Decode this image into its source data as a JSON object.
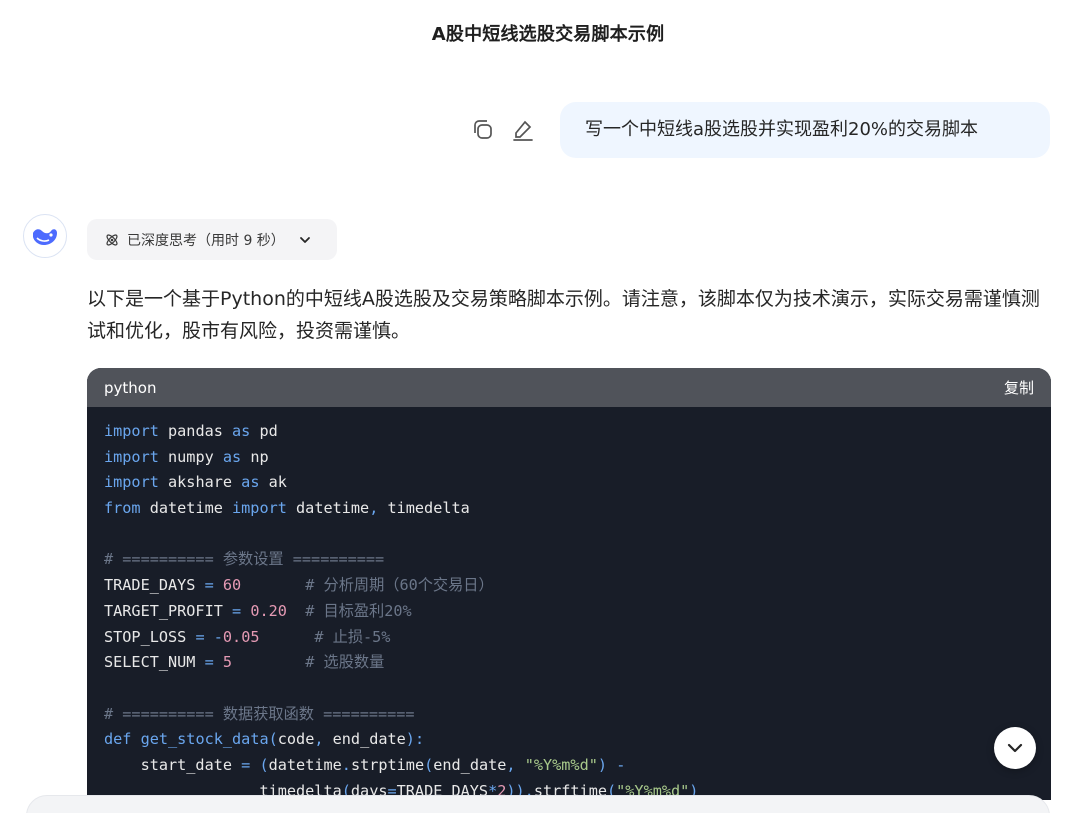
{
  "header": {
    "title": "A股中短线选股交易脚本示例"
  },
  "user_message": {
    "text": "写一个中短线a股选股并实现盈利20%的交易脚本"
  },
  "assistant": {
    "thinking_label": "已深度思考（用时 9 秒）",
    "intro": "以下是一个基于Python的中短线A股选股及交易策略脚本示例。请注意，该脚本仅为技术演示，实际交易需谨慎测试和优化，股市有风险，投资需谨慎。",
    "code": {
      "language": "python",
      "copy_label": "复制",
      "lines": [
        [
          [
            "kw",
            "import"
          ],
          [
            "t",
            " pandas "
          ],
          [
            "kw",
            "as"
          ],
          [
            "t",
            " pd"
          ]
        ],
        [
          [
            "kw",
            "import"
          ],
          [
            "t",
            " numpy "
          ],
          [
            "kw",
            "as"
          ],
          [
            "t",
            " np"
          ]
        ],
        [
          [
            "kw",
            "import"
          ],
          [
            "t",
            " akshare "
          ],
          [
            "kw",
            "as"
          ],
          [
            "t",
            " ak"
          ]
        ],
        [
          [
            "kw",
            "from"
          ],
          [
            "t",
            " datetime "
          ],
          [
            "kw",
            "import"
          ],
          [
            "t",
            " datetime"
          ],
          [
            "op",
            ","
          ],
          [
            "t",
            " timedelta"
          ]
        ],
        [],
        [
          [
            "cm",
            "# ========== 参数设置 =========="
          ]
        ],
        [
          [
            "t",
            "TRADE_DAYS "
          ],
          [
            "op",
            "="
          ],
          [
            "t",
            " "
          ],
          [
            "num",
            "60"
          ],
          [
            "t",
            "       "
          ],
          [
            "cm",
            "# 分析周期（60个交易日）"
          ]
        ],
        [
          [
            "t",
            "TARGET_PROFIT "
          ],
          [
            "op",
            "="
          ],
          [
            "t",
            " "
          ],
          [
            "num",
            "0.20"
          ],
          [
            "t",
            "  "
          ],
          [
            "cm",
            "# 目标盈利20%"
          ]
        ],
        [
          [
            "t",
            "STOP_LOSS "
          ],
          [
            "op",
            "="
          ],
          [
            "t",
            " "
          ],
          [
            "op",
            "-"
          ],
          [
            "num",
            "0.05"
          ],
          [
            "t",
            "      "
          ],
          [
            "cm",
            "# 止损-5%"
          ]
        ],
        [
          [
            "t",
            "SELECT_NUM "
          ],
          [
            "op",
            "="
          ],
          [
            "t",
            " "
          ],
          [
            "num",
            "5"
          ],
          [
            "t",
            "        "
          ],
          [
            "cm",
            "# 选股数量"
          ]
        ],
        [],
        [
          [
            "cm",
            "# ========== 数据获取函数 =========="
          ]
        ],
        [
          [
            "kw",
            "def"
          ],
          [
            "t",
            " "
          ],
          [
            "fn",
            "get_stock_data"
          ],
          [
            "op",
            "("
          ],
          [
            "t",
            "code"
          ],
          [
            "op",
            ","
          ],
          [
            "t",
            " end_date"
          ],
          [
            "op",
            "):"
          ]
        ],
        [
          [
            "t",
            "    start_date "
          ],
          [
            "op",
            "="
          ],
          [
            "t",
            " "
          ],
          [
            "op",
            "("
          ],
          [
            "t",
            "datetime"
          ],
          [
            "op",
            "."
          ],
          [
            "t",
            "strptime"
          ],
          [
            "op",
            "("
          ],
          [
            "t",
            "end_date"
          ],
          [
            "op",
            ","
          ],
          [
            "t",
            " "
          ],
          [
            "str",
            "\"%Y%m%d\""
          ],
          [
            "op",
            ")"
          ],
          [
            "t",
            " "
          ],
          [
            "op",
            "-"
          ]
        ],
        [
          [
            "t",
            "                 timedelta"
          ],
          [
            "op",
            "("
          ],
          [
            "t",
            "days"
          ],
          [
            "op",
            "="
          ],
          [
            "t",
            "TRADE_DAYS"
          ],
          [
            "op",
            "*"
          ],
          [
            "num",
            "2"
          ],
          [
            "op",
            "))."
          ],
          [
            "t",
            "strftime"
          ],
          [
            "op",
            "("
          ],
          [
            "str",
            "\"%Y%m%d\""
          ],
          [
            "op",
            ")"
          ]
        ]
      ]
    }
  },
  "colors": {
    "user_bubble": "#eff6ff",
    "code_bg": "#181d28",
    "code_header": "#50535a",
    "keyword": "#6aa6ee",
    "number": "#e59ab4",
    "comment": "#6b7689",
    "string": "#a8c98b"
  },
  "icons": [
    "copy-icon",
    "edit-icon",
    "deepseek-whale-icon",
    "atom-icon",
    "chevron-down-icon",
    "scroll-down-icon"
  ]
}
